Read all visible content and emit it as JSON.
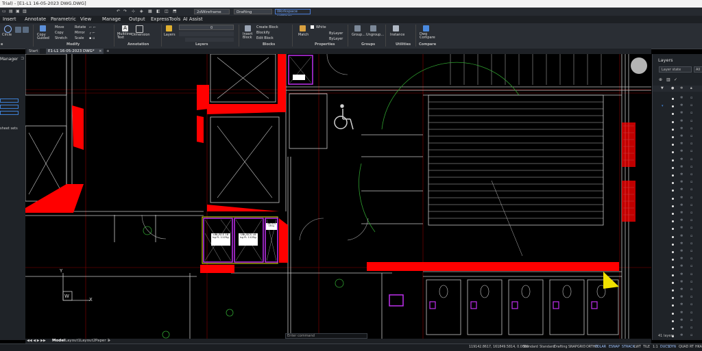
{
  "window": {
    "title": "Trial) - [E1-L1 16-05-2023 DWG.DWG]"
  },
  "quick_access": {
    "visual_style": "2dWireframe",
    "workspace": "Drafting",
    "link": "Workspace settings"
  },
  "menu": [
    "Insert",
    "Annotate",
    "Parametric",
    "View",
    "Manage",
    "Output",
    "ExpressTools",
    "AI Assist"
  ],
  "ribbon": {
    "panels": {
      "draw": "e",
      "modify": "Modify",
      "annotation": "Annotation",
      "layers": "Layers",
      "blocks": "Blocks",
      "properties": "Properties",
      "groups": "Groups",
      "utilities": "Utilities",
      "compare": "Compare"
    },
    "buttons": {
      "circle": "Circle",
      "copy_guided": "Copy Guided",
      "move": "Move",
      "copy": "Copy",
      "stretch": "Stretch",
      "rotate": "Rotate",
      "mirror": "Mirror",
      "scale": "Scale",
      "multiline_text": "Multiline Text",
      "dimension": "Dimension",
      "layers": "Layers",
      "layer_value": "0",
      "insert_block": "Insert Block",
      "create_block": "Create Block",
      "blockify": "Blockify",
      "edit_block": "Edit Block",
      "match": "Match",
      "color": "White",
      "linetype": "ByLayer",
      "lineweight": "ByLayer",
      "group": "Group...",
      "ungroup": "Ungroup...",
      "instance": "Instance",
      "dwg_compare": "Dwg Compare"
    }
  },
  "file_tabs": [
    "Start",
    "E1-L1 16-05-2023 DWG*",
    "+"
  ],
  "left_panel": {
    "title": "Manager",
    "text": "sheet sets"
  },
  "right_panel": {
    "title": "Layers",
    "filter": "Layer state",
    "filter2": "All",
    "count": "41 layers"
  },
  "canvas": {
    "labels": [
      "UBL/SCS 18 kg FL 1125g",
      "UBL/SCS 18 kg FL 1125g",
      "UBL/SCS 18 kg"
    ],
    "ucs": {
      "y": "Y",
      "w": "W",
      "x": "X"
    }
  },
  "command_line": {
    "placeholder": "Enter command"
  },
  "layout_tabs": [
    "Model",
    "Layout1",
    "Layout2",
    "Paper 1",
    "+"
  ],
  "status": {
    "coords": "119142.8617, 161849.5814, 0.0000",
    "items": [
      "Standard",
      "Standard",
      "Drafting",
      "SNAP",
      "GRID",
      "ORTHO",
      "POLAR",
      "ESNAP",
      "STRACK",
      "LWT",
      "TILE",
      "1:1",
      "DUCS",
      "DYN",
      "QUAD",
      "RT",
      "HKA"
    ]
  },
  "colors": {
    "red": "#ff0000",
    "magenta": "#c030f0",
    "yellow": "#f0e000",
    "green": "#30b030",
    "accent": "#4a7bd4"
  }
}
